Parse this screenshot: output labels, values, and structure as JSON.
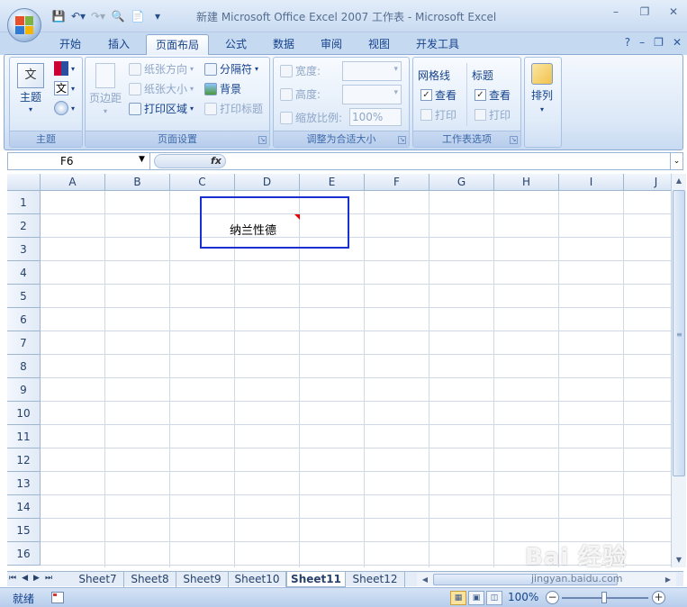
{
  "window": {
    "title": "新建 Microsoft Office Excel 2007 工作表 - Microsoft Excel",
    "controls": [
      "–",
      "❐",
      "✕"
    ],
    "doc_controls": [
      "?",
      "–",
      "❐",
      "✕"
    ]
  },
  "tabs": [
    {
      "label": "开始"
    },
    {
      "label": "插入"
    },
    {
      "label": "页面布局"
    },
    {
      "label": "公式"
    },
    {
      "label": "数据"
    },
    {
      "label": "审阅"
    },
    {
      "label": "视图"
    },
    {
      "label": "开发工具"
    }
  ],
  "ribbon": {
    "theme": {
      "label": "主题",
      "btn": "主题",
      "colors_icon": "color-swatch-icon",
      "fonts_char": "文",
      "effects_icon": "effects-icon"
    },
    "page_setup": {
      "label": "页面设置",
      "margins": "页边距",
      "orientation": "纸张方向",
      "size": "纸张大小",
      "print_area": "打印区域",
      "breaks": "分隔符",
      "background": "背景",
      "print_titles": "打印标题"
    },
    "scale": {
      "label": "调整为合适大小",
      "width": "宽度:",
      "height": "高度:",
      "scale": "缩放比例:",
      "scale_value": "100%"
    },
    "sheet_options": {
      "label": "工作表选项",
      "gridlines": "网格线",
      "headings": "标题",
      "view": "查看",
      "print": "打印"
    },
    "arrange": {
      "label": "排列"
    }
  },
  "formula_bar": {
    "name_box": "F6",
    "fx": "fx"
  },
  "columns": [
    "A",
    "B",
    "C",
    "D",
    "E",
    "F",
    "G",
    "H",
    "I",
    "J"
  ],
  "rows": [
    "1",
    "2",
    "3",
    "4",
    "5",
    "6",
    "7",
    "8",
    "9",
    "10",
    "11",
    "12",
    "13",
    "14",
    "15",
    "16"
  ],
  "cell_content": {
    "ref": "D2",
    "text": "纳兰性德"
  },
  "sheets": [
    "Sheet7",
    "Sheet8",
    "Sheet9",
    "Sheet10",
    "Sheet11",
    "Sheet12"
  ],
  "active_sheet": "Sheet11",
  "status": {
    "text": "就绪",
    "zoom": "100%"
  },
  "watermark": {
    "text": "Bai 经验",
    "url": "jingyan.baidu.com"
  }
}
